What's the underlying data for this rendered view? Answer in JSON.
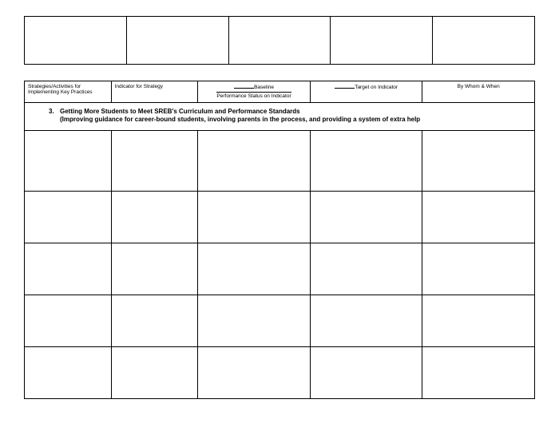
{
  "headers": {
    "col1": "Strategies/Activities for Implementing Key Practices",
    "col2": "Indicator for Strategy",
    "col3_prefix": "Baseline",
    "col3_sub": "Performance Status on Indicator",
    "col4": "Target on Indicator",
    "col5": "By Whom & When"
  },
  "section": {
    "number": "3.",
    "title_line1": "Getting More Students to Meet SREB's Curriculum and Performance Standards",
    "title_line2": "(Improving guidance for career-bound students, involving parents in the process, and providing a system of extra help"
  }
}
